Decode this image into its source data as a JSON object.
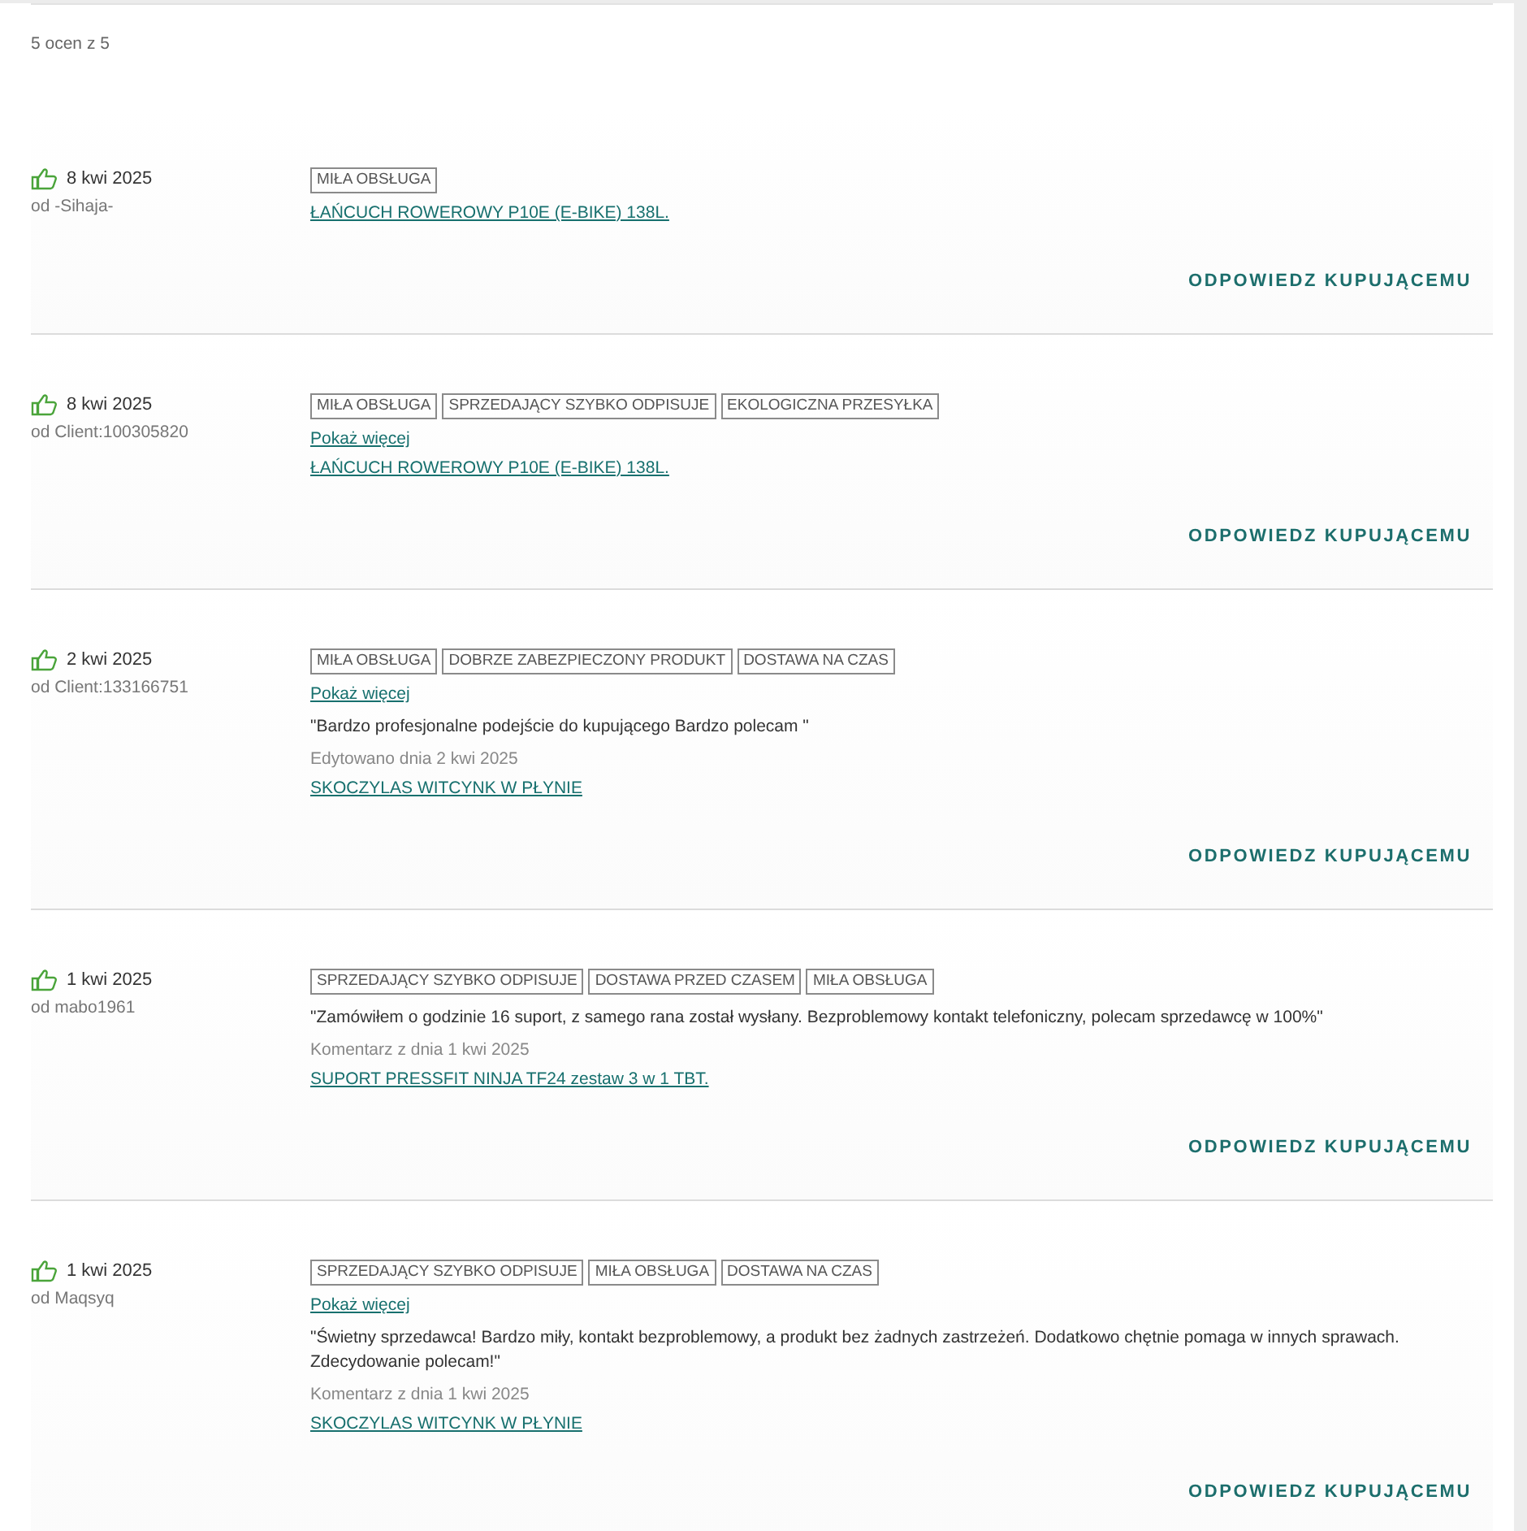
{
  "summary": "5 ocen z 5",
  "reviews": [
    {
      "date": "8 kwi 2025",
      "author": "od -Sihaja-",
      "tags": [
        "MIŁA OBSŁUGA"
      ],
      "product": "ŁAŃCUCH ROWEROWY P10E (E-BIKE) 138L.",
      "reply": "ODPOWIEDZ KUPUJĄCEMU"
    },
    {
      "date": "8 kwi 2025",
      "author": "od Client:100305820",
      "tags": [
        "MIŁA OBSŁUGA",
        "SPRZEDAJĄCY SZYBKO ODPISUJE",
        "EKOLOGICZNA PRZESYŁKA"
      ],
      "show_more": "Pokaż więcej",
      "product": "ŁAŃCUCH ROWEROWY P10E (E-BIKE) 138L.",
      "reply": "ODPOWIEDZ KUPUJĄCEMU"
    },
    {
      "date": "2 kwi 2025",
      "author": "od Client:133166751",
      "tags": [
        "MIŁA OBSŁUGA",
        "DOBRZE ZABEZPIECZONY PRODUKT",
        "DOSTAWA NA CZAS"
      ],
      "show_more": "Pokaż więcej",
      "comment": "\"Bardzo profesjonalne podejście do kupującego Bardzo polecam \"",
      "note": "Edytowano dnia 2 kwi 2025",
      "product": "SKOCZYLAS WITCYNK W PŁYNIE",
      "reply": "ODPOWIEDZ KUPUJĄCEMU"
    },
    {
      "date": "1 kwi 2025",
      "author": "od mabo1961",
      "tags": [
        "SPRZEDAJĄCY SZYBKO ODPISUJE",
        "DOSTAWA PRZED CZASEM",
        "MIŁA OBSŁUGA"
      ],
      "comment": "\"Zamówiłem o godzinie 16 suport, z samego rana został wysłany. Bezproblemowy kontakt telefoniczny, polecam sprzedawcę w 100%\"",
      "note": "Komentarz z dnia 1 kwi 2025",
      "product": "SUPORT PRESSFIT NINJA TF24 zestaw 3 w 1 TBT.",
      "reply": "ODPOWIEDZ KUPUJĄCEMU"
    },
    {
      "date": "1 kwi 2025",
      "author": "od Maqsyq",
      "tags": [
        "SPRZEDAJĄCY SZYBKO ODPISUJE",
        "MIŁA OBSŁUGA",
        "DOSTAWA NA CZAS"
      ],
      "show_more": "Pokaż więcej",
      "comment": "\"Świetny sprzedawca! Bardzo miły, kontakt bezproblemowy, a produkt bez żadnych zastrzeżeń. Dodatkowo chętnie pomaga w innych sprawach. Zdecydowanie polecam!\"",
      "note": "Komentarz z dnia 1 kwi 2025",
      "product": "SKOCZYLAS WITCYNK W PŁYNIE",
      "reply": "ODPOWIEDZ KUPUJĄCEMU"
    }
  ]
}
